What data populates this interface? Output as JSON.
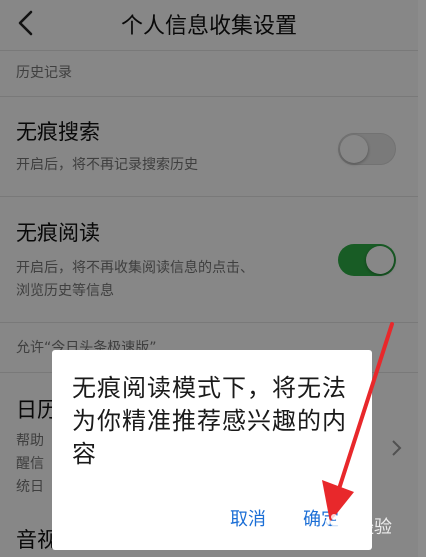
{
  "header": {
    "title": "个人信息收集设置"
  },
  "history_section": {
    "label": "历史记录"
  },
  "settings": [
    {
      "title": "无痕搜索",
      "description": "开启后，将不再记录搜索历史",
      "enabled": false
    },
    {
      "title": "无痕阅读",
      "description_lines": [
        "开启后，将不再收集阅读信息的点击、",
        "浏览历史等信息"
      ],
      "enabled": true
    }
  ],
  "allow_section": {
    "text": "允许“今日头条极速版”"
  },
  "calendar": {
    "title_partial": "日历",
    "desc_lines": [
      "帮助",
      "醒信",
      "统日"
    ]
  },
  "bottom_item": {
    "title_partial": "音视频信息（摄像头）"
  },
  "dialog": {
    "message": "无痕阅读模式下，将无法为你精准推荐感兴趣的内容",
    "cancel_label": "取消",
    "confirm_label": "确定"
  },
  "watermark": {
    "text": "经验"
  },
  "colors": {
    "toggle_on": "#2fae47",
    "dialog_button": "#1c6fd6",
    "annotation_arrow": "#e8282b"
  }
}
